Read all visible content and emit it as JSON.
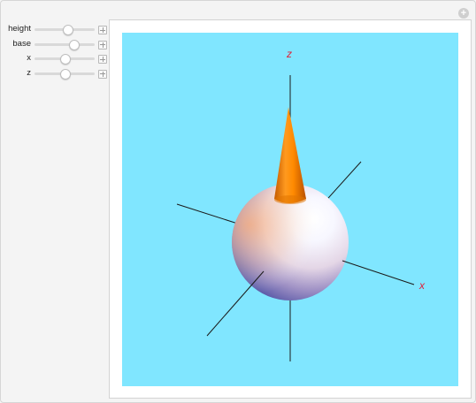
{
  "controls": [
    {
      "label": "height",
      "value": 0.55
    },
    {
      "label": "base",
      "value": 0.65
    },
    {
      "label": "x",
      "value": 0.5
    },
    {
      "label": "z",
      "value": 0.5
    }
  ],
  "plot": {
    "background": "#80e6ff",
    "axis_labels": {
      "z": "z",
      "x": "x"
    },
    "label_color": "#e0213a",
    "cone_color": "#ff8c00",
    "sphere_colors": [
      "#ffe3cc",
      "#ffffff",
      "#6a64b5"
    ]
  },
  "icons": {
    "top_right": "plus-circle-icon"
  }
}
